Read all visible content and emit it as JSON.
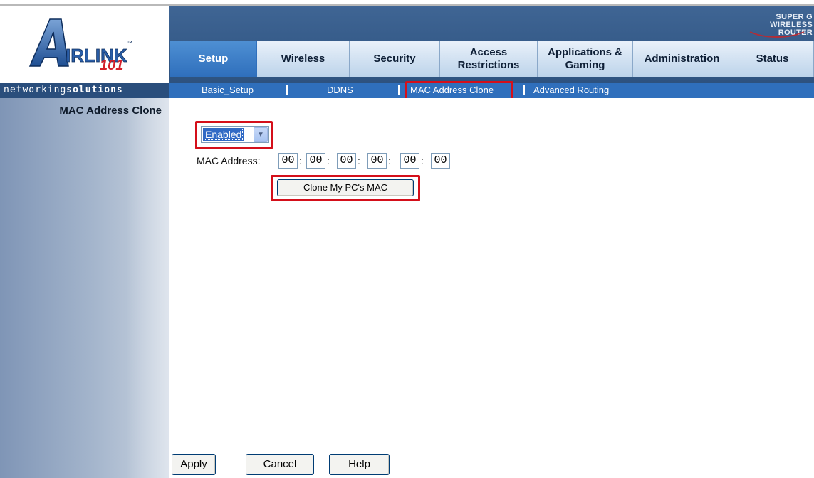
{
  "logo": {
    "brand": "AIRLINK",
    "number": "101",
    "tagline_prefix": "networking",
    "tagline_suffix": "solutions",
    "badge_line1": "SUPER G",
    "badge_line2": "WIRELESS ROUTER"
  },
  "tabs": [
    {
      "label": "Setup",
      "active": true
    },
    {
      "label": "Wireless",
      "active": false
    },
    {
      "label": "Security",
      "active": false
    },
    {
      "label": "Access Restrictions",
      "active": false
    },
    {
      "label": "Applications & Gaming",
      "active": false
    },
    {
      "label": "Administration",
      "active": false
    },
    {
      "label": "Status",
      "active": false
    }
  ],
  "subnav": [
    {
      "label": "Basic_Setup"
    },
    {
      "label": "DDNS"
    },
    {
      "label": "MAC Address Clone",
      "active": true
    },
    {
      "label": "Advanced Routing"
    }
  ],
  "sidebar": {
    "title": "MAC Address Clone"
  },
  "clone": {
    "mode_value": "Enabled",
    "mac_label": "MAC Address:",
    "mac_octets": [
      "00",
      "00",
      "00",
      "00",
      "00",
      "00"
    ],
    "clone_button": "Clone My PC's MAC"
  },
  "footer": {
    "apply": "Apply",
    "cancel": "Cancel",
    "help": "Help"
  },
  "colors": {
    "highlight": "#d40f1a",
    "nav_blue": "#2f6fbc",
    "header_blue": "#3f6594"
  }
}
